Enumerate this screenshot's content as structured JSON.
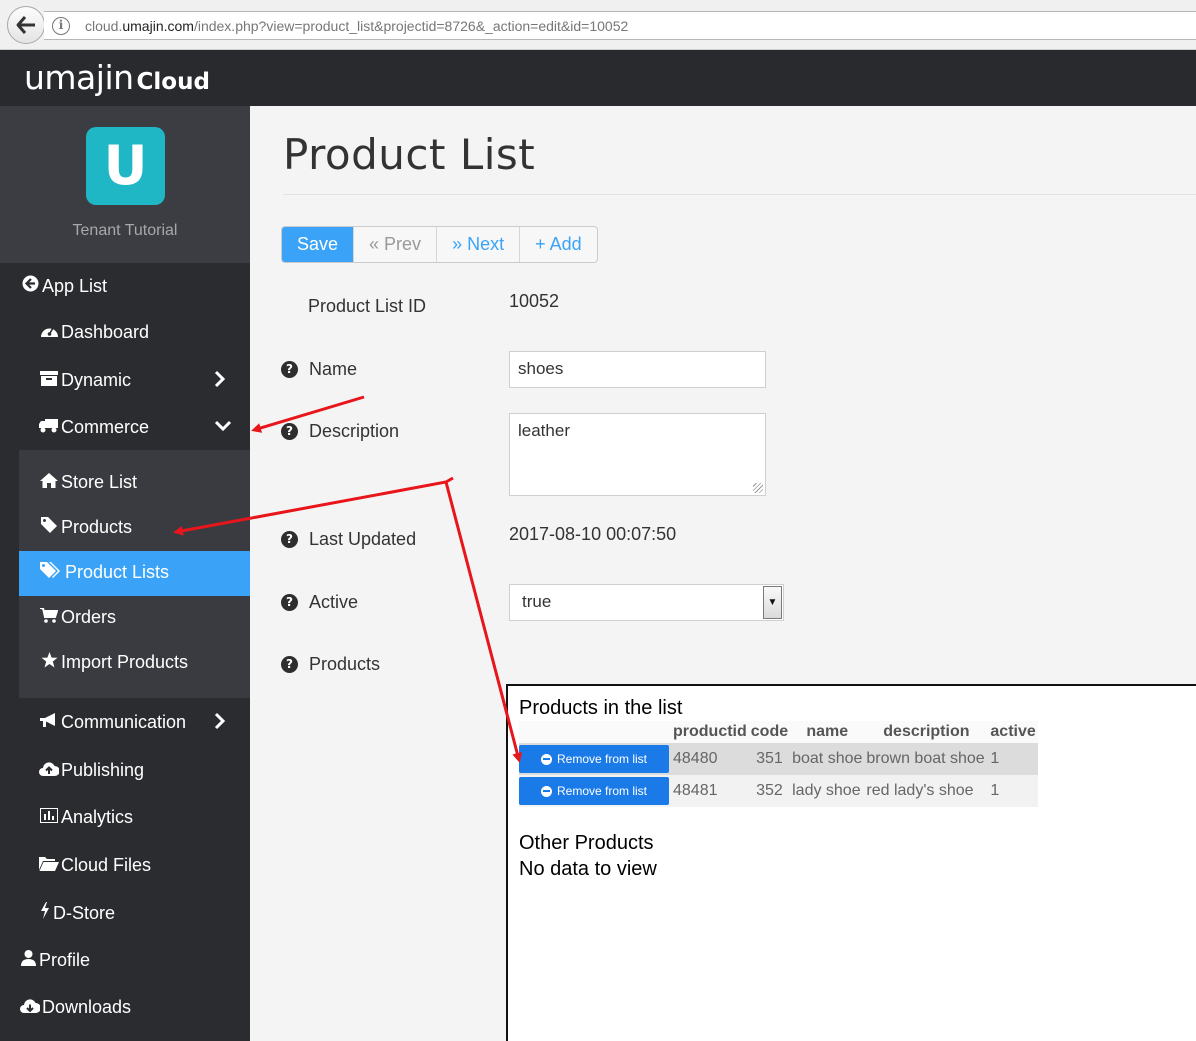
{
  "browser": {
    "url_prefix": "cloud.",
    "url_domain": "umajin.com",
    "url_rest": "/index.php?view=product_list&projectid=8726&_action=edit&id=10052"
  },
  "header": {
    "logo_main": "umajin",
    "logo_suffix": "Cloud"
  },
  "tenant": {
    "logo_letter": "U",
    "name": "Tenant Tutorial"
  },
  "sidebar": {
    "app_list": "App List",
    "dashboard": "Dashboard",
    "dynamic": "Dynamic",
    "commerce": "Commerce",
    "store_list": "Store List",
    "products": "Products",
    "product_lists": "Product Lists",
    "orders": "Orders",
    "import_products": "Import Products",
    "communication": "Communication",
    "publishing": "Publishing",
    "analytics": "Analytics",
    "cloud_files": "Cloud Files",
    "d_store": "D-Store",
    "profile": "Profile",
    "downloads": "Downloads"
  },
  "page": {
    "title": "Product List"
  },
  "toolbar": {
    "save": "Save",
    "prev": "« Prev",
    "next": "» Next",
    "add": "+ Add"
  },
  "form": {
    "id_label": "Product List ID",
    "id_value": "10052",
    "name_label": "Name",
    "name_value": "shoes",
    "description_label": "Description",
    "description_value": "leather",
    "last_updated_label": "Last Updated",
    "last_updated_value": "2017-08-10 00:07:50",
    "active_label": "Active",
    "active_value": "true",
    "products_label": "Products"
  },
  "products_panel": {
    "in_list_title": "Products in the list",
    "columns": [
      "productid",
      "code",
      "name",
      "description",
      "active"
    ],
    "remove_label": "Remove from list",
    "rows": [
      {
        "productid": "48480",
        "code": "351",
        "name": "boat shoe",
        "description": "brown boat shoe",
        "active": "1"
      },
      {
        "productid": "48481",
        "code": "352",
        "name": "lady shoe",
        "description": "red lady's shoe",
        "active": "1"
      }
    ],
    "other_title": "Other Products",
    "other_empty": "No data to view"
  },
  "colors": {
    "accent": "#3ba3f7",
    "sidebar": "#2b2c30",
    "topbar": "#282a2e",
    "tenant_logo": "#1fb6c6",
    "arrow": "#e8151a"
  }
}
